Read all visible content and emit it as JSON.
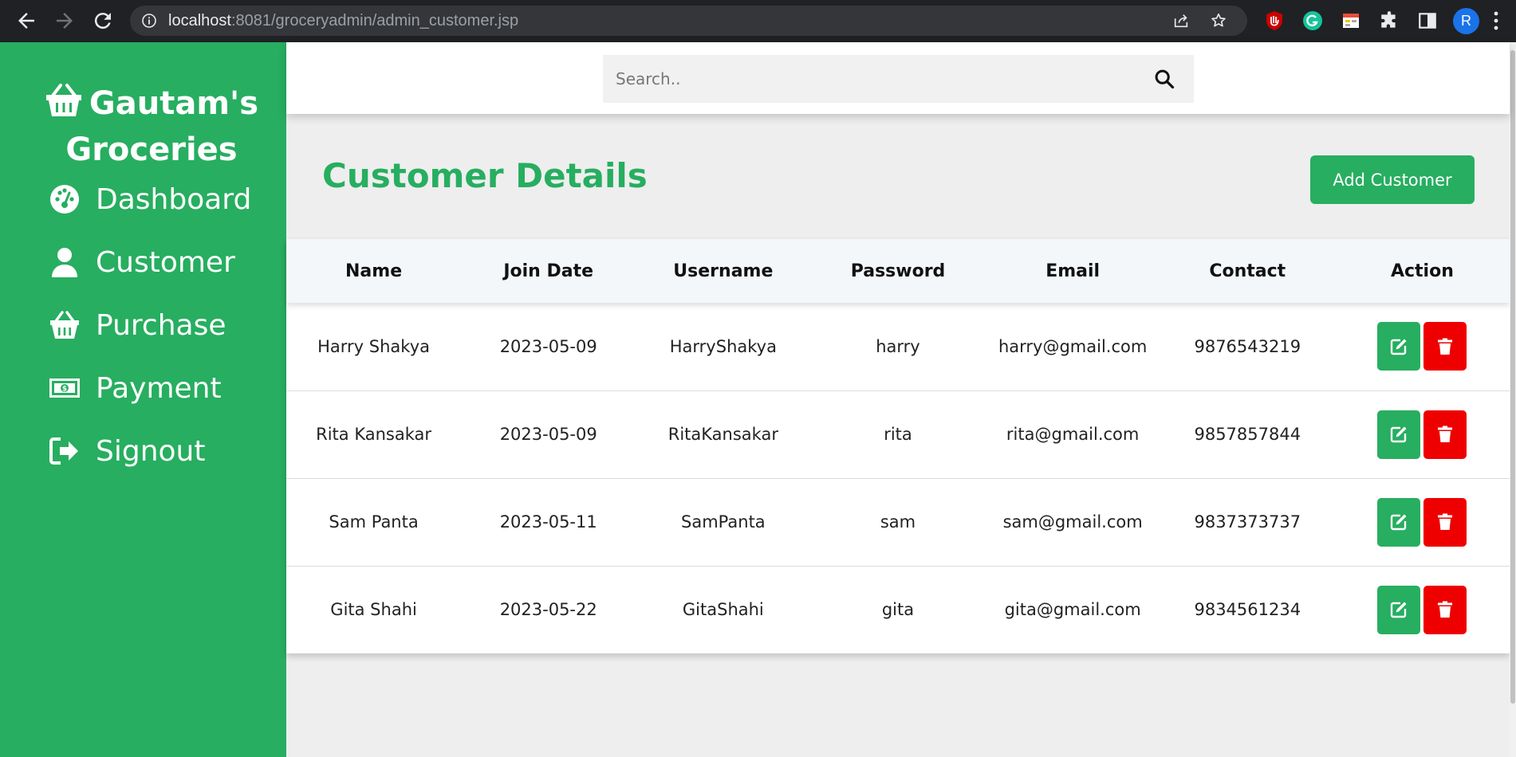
{
  "browser": {
    "url_host": "localhost",
    "url_rest": ":8081/groceryadmin/admin_customer.jsp",
    "profile_initial": "R"
  },
  "sidebar": {
    "brand": "Gautam's Groceries",
    "items": [
      {
        "label": "Dashboard",
        "icon": "dashboard-gauge-icon"
      },
      {
        "label": "Customer",
        "icon": "user-icon"
      },
      {
        "label": "Purchase",
        "icon": "basket-icon"
      },
      {
        "label": "Payment",
        "icon": "money-bill-icon"
      },
      {
        "label": "Signout",
        "icon": "sign-out-icon"
      }
    ]
  },
  "search": {
    "placeholder": "Search.."
  },
  "main": {
    "title": "Customer Details",
    "add_button": "Add Customer"
  },
  "table": {
    "headers": [
      "Name",
      "Join Date",
      "Username",
      "Password",
      "Email",
      "Contact",
      "Action"
    ],
    "rows": [
      [
        "Harry Shakya",
        "2023-05-09",
        "HarryShakya",
        "harry",
        "harry@gmail.com",
        "9876543219"
      ],
      [
        "Rita Kansakar",
        "2023-05-09",
        "RitaKansakar",
        "rita",
        "rita@gmail.com",
        "9857857844"
      ],
      [
        "Sam Panta",
        "2023-05-11",
        "SamPanta",
        "sam",
        "sam@gmail.com",
        "9837373737"
      ],
      [
        "Gita Shahi",
        "2023-05-22",
        "GitaShahi",
        "gita",
        "gita@gmail.com",
        "9834561234"
      ]
    ]
  },
  "colors": {
    "brand_green": "#27ae60",
    "delete_red": "#ee0000",
    "chrome_dark": "#202124"
  }
}
